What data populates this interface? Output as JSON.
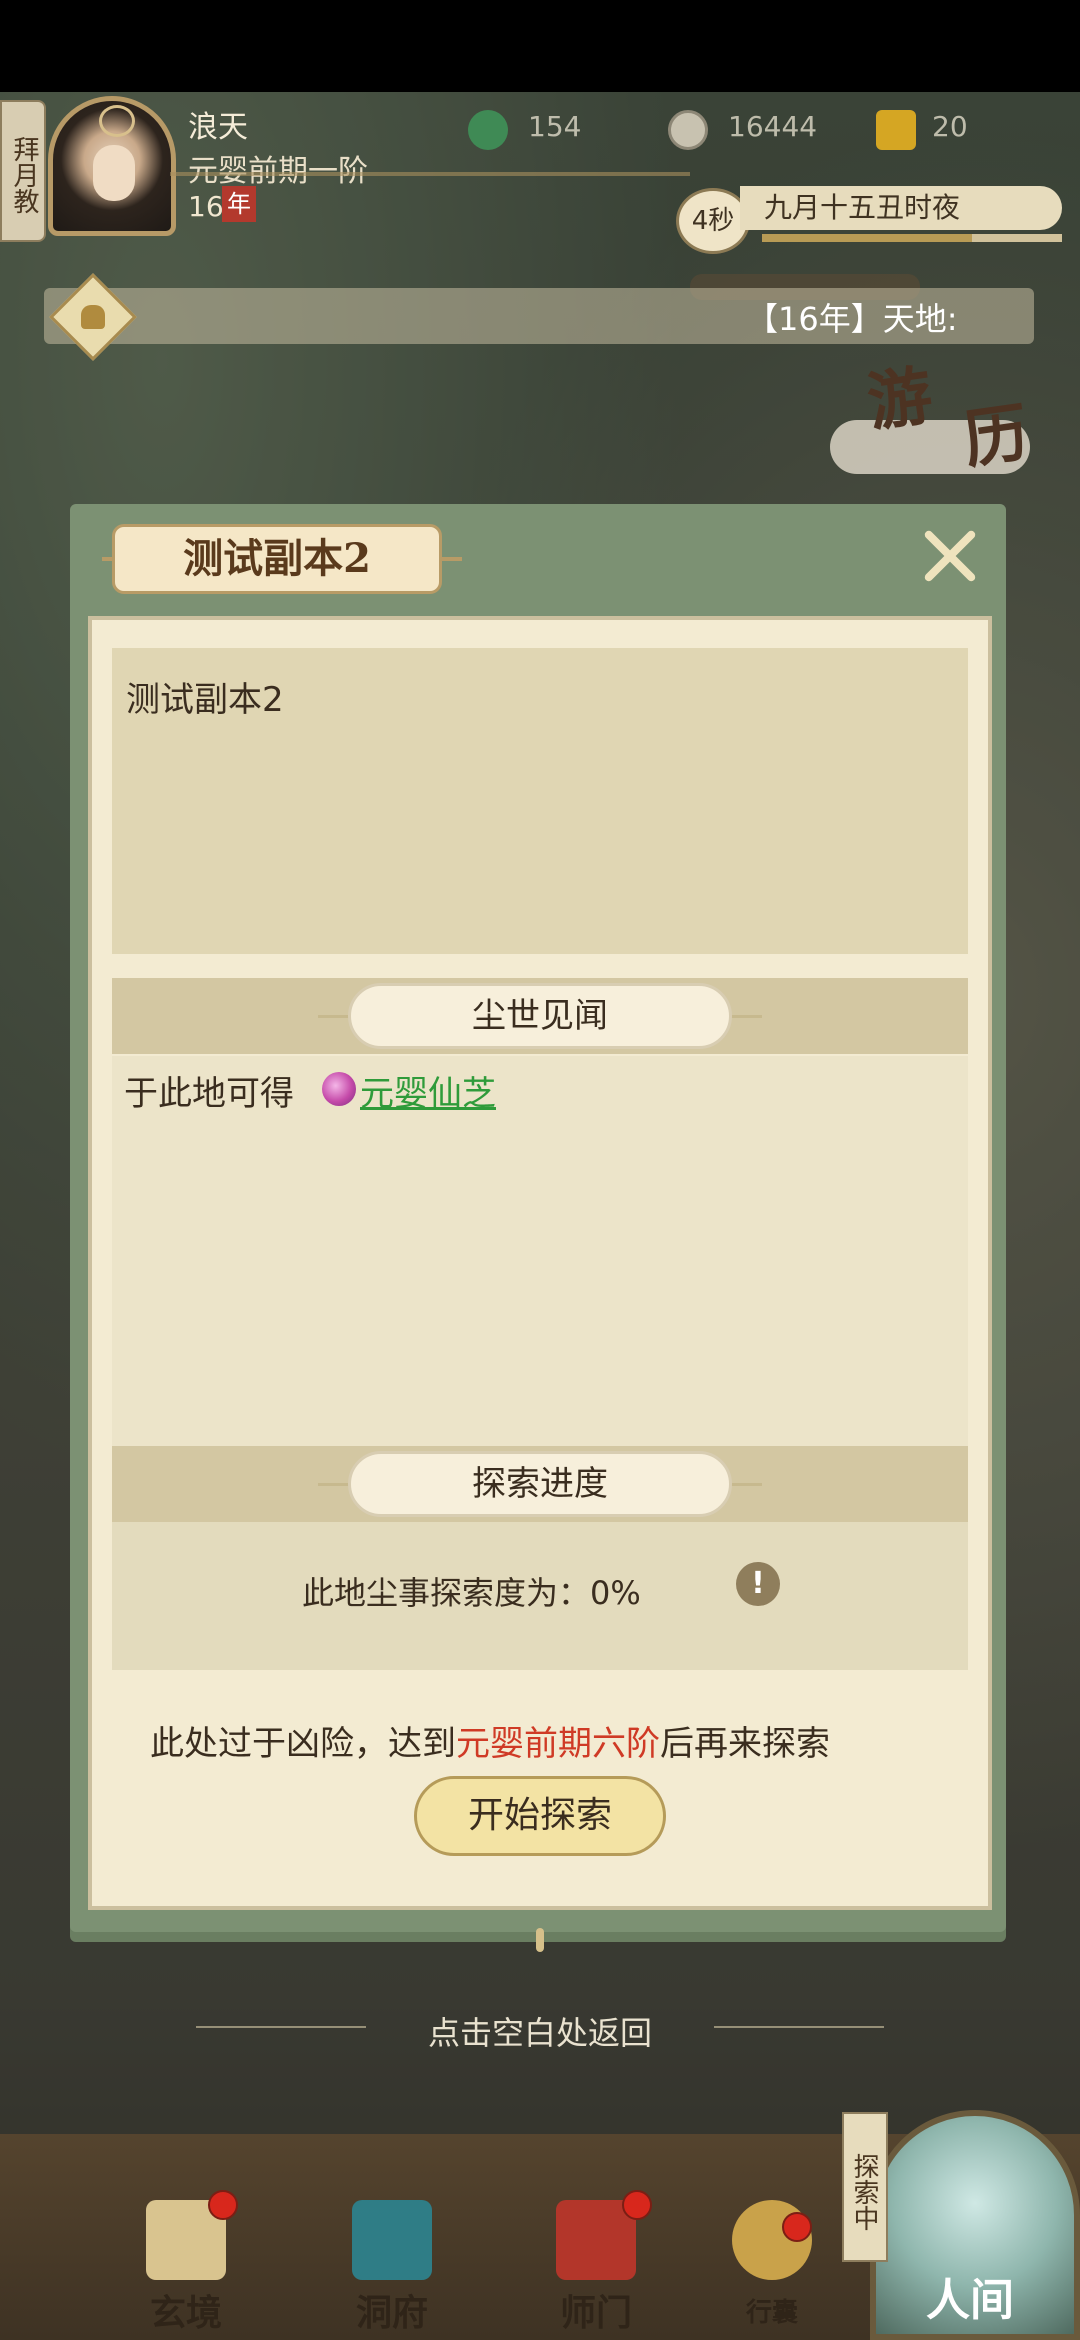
{
  "header": {
    "sect_tag": "拜月教",
    "player": {
      "name": "浪天",
      "rank": "元婴前期一阶",
      "age": "16",
      "age_unit": "年"
    },
    "currencies": [
      {
        "icon": "jade-icon",
        "value": "154"
      },
      {
        "icon": "coin-icon",
        "value": "16444"
      },
      {
        "icon": "ingot-icon",
        "value": "20"
      }
    ],
    "timer": "4秒",
    "date": "九月十五丑时夜",
    "date_progress": 0.7
  },
  "marquee": {
    "text": "【16年】天地:"
  },
  "map_badge": {
    "text": "游历"
  },
  "modal": {
    "title": "测试副本2",
    "description": "测试副本2",
    "section_loot": "尘世见闻",
    "loot_prefix": "于此地可得",
    "loot_item": "元婴仙芝",
    "section_progress": "探索进度",
    "progress_text": "此地尘事探索度为：0%",
    "warning_prefix": "此处过于凶险，达到",
    "warning_highlight": "元婴前期六阶",
    "warning_suffix": "后再来探索",
    "start_button": "开始探索"
  },
  "hint": "点击空白处返回",
  "bottom_nav": {
    "items": [
      {
        "label": "玄境"
      },
      {
        "label": "洞府"
      },
      {
        "label": "师门"
      },
      {
        "label": "行囊"
      }
    ],
    "explore_tag": "探索中",
    "world": "人间"
  },
  "colors": {
    "highlight": "#cf3a25",
    "link": "#2f9b3a",
    "accent_green": "#7c9173"
  }
}
